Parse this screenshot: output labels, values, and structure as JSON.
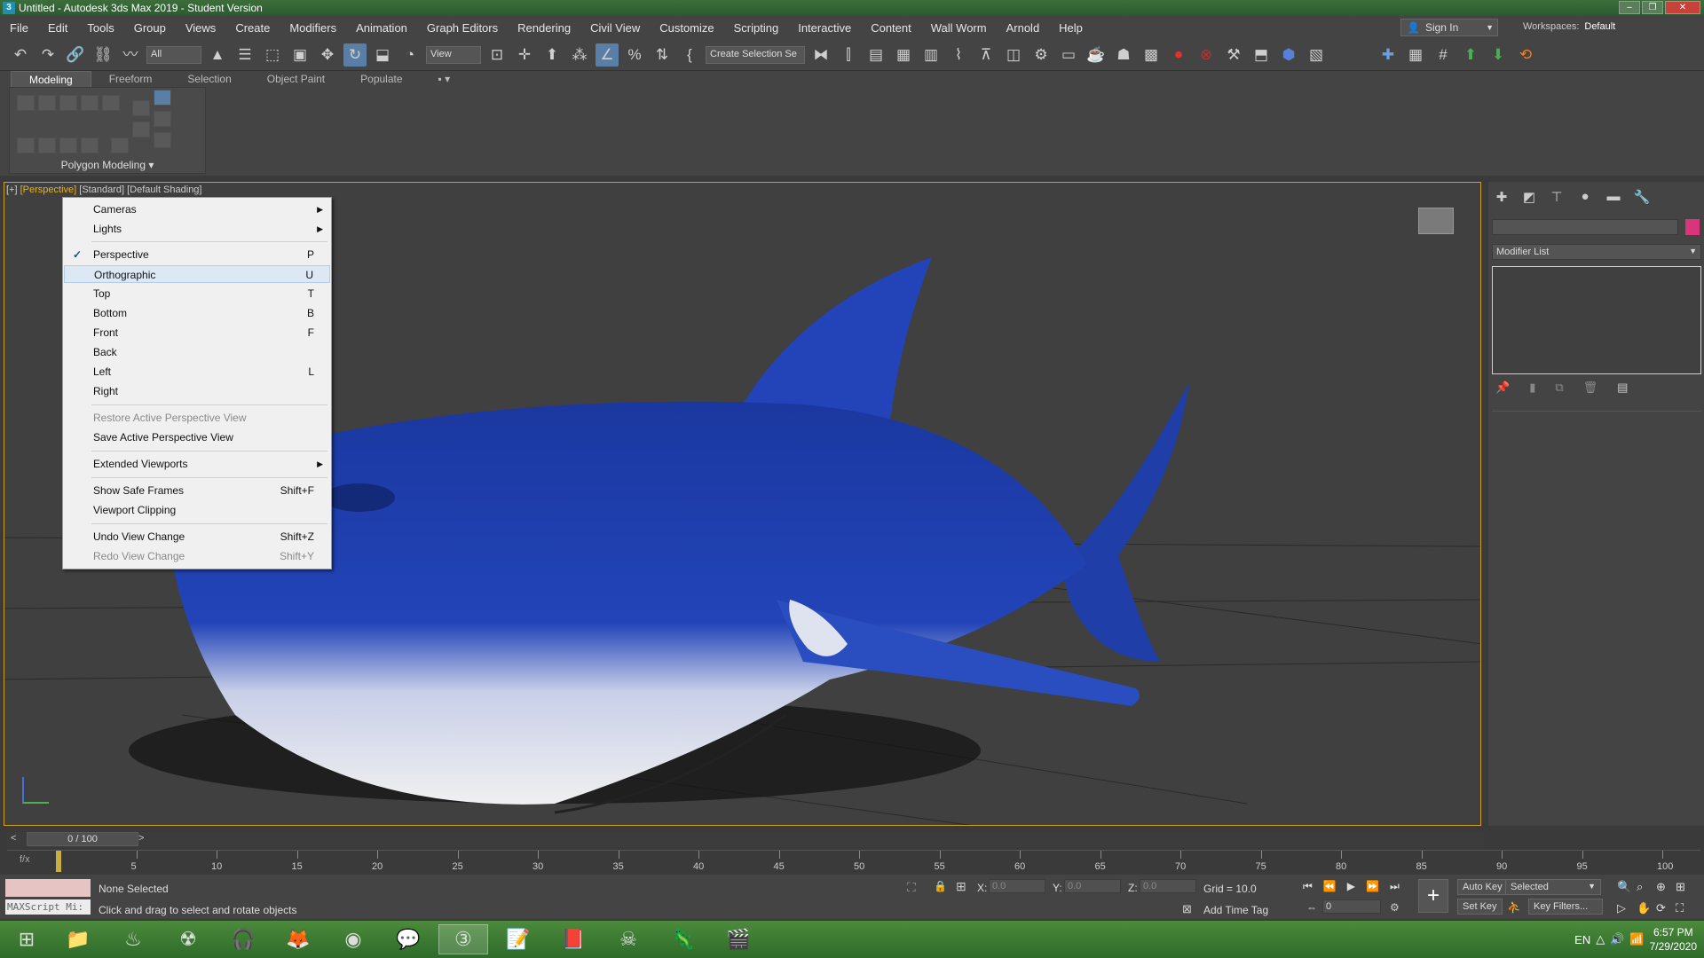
{
  "window": {
    "title": "Untitled - Autodesk 3ds Max 2019 - Student Version",
    "app_icon": "3",
    "controls": [
      "minimize-icon",
      "restore-icon",
      "close-icon"
    ],
    "minimize_glyph": "–",
    "restore_glyph": "❐",
    "close_glyph": "✕"
  },
  "menubar": {
    "items": [
      "File",
      "Edit",
      "Tools",
      "Group",
      "Views",
      "Create",
      "Modifiers",
      "Animation",
      "Graph Editors",
      "Rendering",
      "Civil View",
      "Customize",
      "Scripting",
      "Interactive",
      "Content",
      "Wall Worm",
      "Arnold",
      "Help"
    ],
    "sign_in": "Sign In",
    "workspaces_label": "Workspaces:",
    "workspaces_value": "Default"
  },
  "toolbar": {
    "selection_filter": "All",
    "reference_coord": "View",
    "named_selection": "Create Selection Se"
  },
  "ribbon": {
    "tabs": [
      "Modeling",
      "Freeform",
      "Selection",
      "Object Paint",
      "Populate"
    ],
    "active_tab": "Modeling",
    "panel_label": "Polygon Modeling"
  },
  "viewport": {
    "label_plus": "[+]",
    "label_view": "[Perspective]",
    "label_standard": "[Standard]",
    "label_shading": "[Default Shading]",
    "colors": {
      "shark_blue": "#1f3fa8",
      "shark_white": "#e8e8e8",
      "border_active": "#d0a020"
    }
  },
  "context_menu": {
    "items": [
      {
        "label": "Cameras",
        "submenu": true
      },
      {
        "label": "Lights",
        "submenu": true
      },
      {
        "label": "Perspective",
        "shortcut": "P",
        "checked": true
      },
      {
        "label": "Orthographic",
        "shortcut": "U",
        "hover": true
      },
      {
        "label": "Top",
        "shortcut": "T"
      },
      {
        "label": "Bottom",
        "shortcut": "B"
      },
      {
        "label": "Front",
        "shortcut": "F"
      },
      {
        "label": "Back",
        "shortcut": ""
      },
      {
        "label": "Left",
        "shortcut": "L"
      },
      {
        "label": "Right",
        "shortcut": ""
      },
      {
        "label": "Restore Active Perspective View",
        "disabled": true
      },
      {
        "label": "Save Active Perspective View"
      },
      {
        "label": "Extended Viewports",
        "submenu": true
      },
      {
        "label": "Show Safe Frames",
        "shortcut": "Shift+F"
      },
      {
        "label": "Viewport Clipping"
      },
      {
        "label": "Undo View Change",
        "shortcut": "Shift+Z"
      },
      {
        "label": "Redo View Change",
        "shortcut": "Shift+Y",
        "disabled": true
      }
    ]
  },
  "command_panel": {
    "modifier_list": "Modifier List",
    "object_color": "#d8357a"
  },
  "timeline": {
    "frame_display": "0 / 100",
    "current_frame": 0,
    "total_frames": 100,
    "ticks": [
      "5",
      "10",
      "15",
      "20",
      "25",
      "30",
      "35",
      "40",
      "45",
      "50",
      "55",
      "60",
      "65",
      "70",
      "75",
      "80",
      "85",
      "90",
      "95",
      "100"
    ]
  },
  "status": {
    "maxscript_placeholder": "MAXScript Mi:",
    "selection": "None Selected",
    "prompt": "Click and drag to select and rotate objects",
    "x_label": "X:",
    "x_value": "0.0",
    "y_label": "Y:",
    "y_value": "0.0",
    "z_label": "Z:",
    "z_value": "0.0",
    "grid": "Grid = 10.0",
    "add_time_tag": "Add Time Tag",
    "auto_key": "Auto Key",
    "key_mode": "Selected",
    "set_key": "Set Key",
    "key_filters": "Key Filters...",
    "frame_spinner": "0"
  },
  "taskbar": {
    "language": "EN",
    "time": "6:57 PM",
    "date": "7/29/2020"
  }
}
